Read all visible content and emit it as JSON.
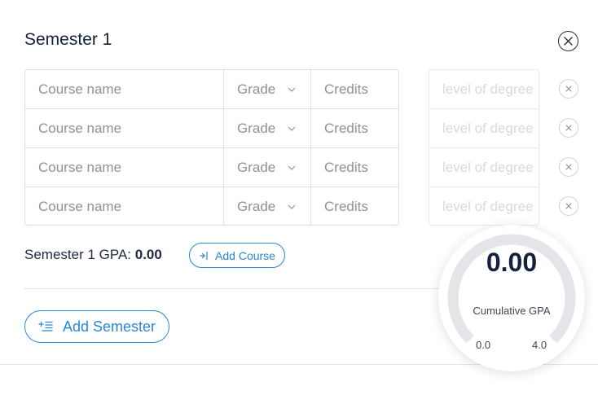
{
  "semester": {
    "title": "Semester 1",
    "gpa_label": "Semester 1 GPA:",
    "gpa_value": "0.00",
    "add_course_label": "Add Course"
  },
  "courses": [
    {
      "name_placeholder": "Course name",
      "grade_label": "Grade",
      "credits_placeholder": "Credits",
      "level_placeholder": "level of degree"
    },
    {
      "name_placeholder": "Course name",
      "grade_label": "Grade",
      "credits_placeholder": "Credits",
      "level_placeholder": "level of degree"
    },
    {
      "name_placeholder": "Course name",
      "grade_label": "Grade",
      "credits_placeholder": "Credits",
      "level_placeholder": "level of degree"
    },
    {
      "name_placeholder": "Course name",
      "grade_label": "Grade",
      "credits_placeholder": "Credits",
      "level_placeholder": "level of degree"
    }
  ],
  "add_semester_label": "Add Semester",
  "gauge": {
    "value": "0.00",
    "label": "Cumulative GPA",
    "min": "0.0",
    "max": "4.0",
    "level": 0
  },
  "colors": {
    "accent": "#2a86d6",
    "title": "#14213d",
    "gauge_track": "#e3e5e8"
  }
}
